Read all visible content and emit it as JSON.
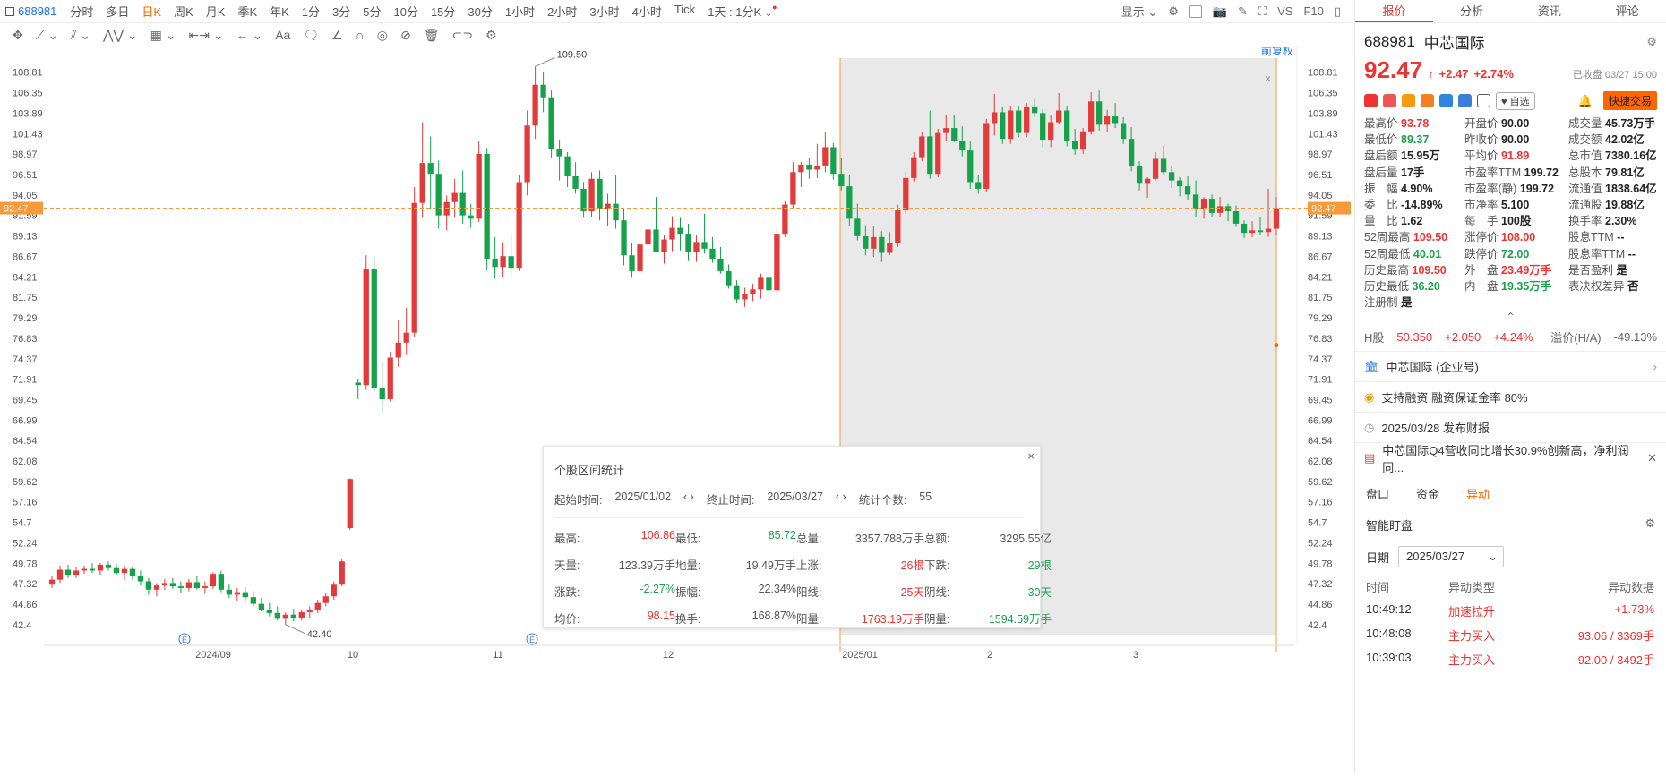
{
  "toolbar": {
    "code": "688981",
    "periods": [
      "分时",
      "多日",
      "日K",
      "周K",
      "月K",
      "季K",
      "年K",
      "1分",
      "3分",
      "5分",
      "10分",
      "15分",
      "30分",
      "1小时",
      "2小时",
      "3小时",
      "4小时",
      "Tick"
    ],
    "active_period": "日K",
    "interval": "1天 : 1分K",
    "display": "显示",
    "vs": "VS",
    "f10": "F10",
    "adjust": "前复权"
  },
  "chart_data": {
    "type": "candlestick",
    "ylim": [
      41.2,
      110.5
    ],
    "y_ticks": [
      108.81,
      106.35,
      103.89,
      101.43,
      98.97,
      96.51,
      94.05,
      91.59,
      89.13,
      86.67,
      84.21,
      81.75,
      79.29,
      76.83,
      74.37,
      71.91,
      69.45,
      66.99,
      64.54,
      62.08,
      59.62,
      57.16,
      54.7,
      52.24,
      49.78,
      47.32,
      44.86,
      42.4
    ],
    "x_labels": [
      "2024/09",
      "10",
      "11",
      "12",
      "2025/01",
      "2",
      "3"
    ],
    "current_price": "92.47",
    "high_label": "109.50",
    "low_label": "42.40",
    "event_markers": [
      "E",
      "E"
    ],
    "candles": [
      [
        47.2,
        48.2,
        46.8,
        47.8
      ],
      [
        47.8,
        49.5,
        47.4,
        49.0
      ],
      [
        49.0,
        49.6,
        48.0,
        48.4
      ],
      [
        48.4,
        49.3,
        48.0,
        48.9
      ],
      [
        48.9,
        49.5,
        48.5,
        49.1
      ],
      [
        49.1,
        49.8,
        48.6,
        48.9
      ],
      [
        48.9,
        49.8,
        48.4,
        49.6
      ],
      [
        49.6,
        50.0,
        48.9,
        49.2
      ],
      [
        49.2,
        49.7,
        48.4,
        48.6
      ],
      [
        48.6,
        49.5,
        47.8,
        49.1
      ],
      [
        49.1,
        49.4,
        47.8,
        48.2
      ],
      [
        48.2,
        48.9,
        47.1,
        47.6
      ],
      [
        47.6,
        48.0,
        46.0,
        46.6
      ],
      [
        46.6,
        47.4,
        45.8,
        47.1
      ],
      [
        47.1,
        47.9,
        46.6,
        47.4
      ],
      [
        47.4,
        48.0,
        46.7,
        47.0
      ],
      [
        47.0,
        47.6,
        46.2,
        46.8
      ],
      [
        46.8,
        47.9,
        46.4,
        47.5
      ],
      [
        47.5,
        48.3,
        46.6,
        46.8
      ],
      [
        46.8,
        47.6,
        46.1,
        47.0
      ],
      [
        47.0,
        48.7,
        46.7,
        48.5
      ],
      [
        48.5,
        48.9,
        46.3,
        46.6
      ],
      [
        46.6,
        47.2,
        45.6,
        46.0
      ],
      [
        46.0,
        46.8,
        45.3,
        46.3
      ],
      [
        46.3,
        46.9,
        45.2,
        45.7
      ],
      [
        45.7,
        46.4,
        44.6,
        44.9
      ],
      [
        44.9,
        45.6,
        44.0,
        44.2
      ],
      [
        44.2,
        45.0,
        43.4,
        43.8
      ],
      [
        43.8,
        44.6,
        42.9,
        43.1
      ],
      [
        43.1,
        43.9,
        42.4,
        43.6
      ],
      [
        43.6,
        44.3,
        42.8,
        43.2
      ],
      [
        43.2,
        44.2,
        42.9,
        43.9
      ],
      [
        43.9,
        44.6,
        43.2,
        44.2
      ],
      [
        44.2,
        45.4,
        43.8,
        45.0
      ],
      [
        45.0,
        46.2,
        44.6,
        45.8
      ],
      [
        45.8,
        47.6,
        45.4,
        47.2
      ],
      [
        47.2,
        50.3,
        47.0,
        50.0
      ],
      [
        54.0,
        60.0,
        53.8,
        59.9
      ],
      [
        71.5,
        72.0,
        69.5,
        71.2
      ],
      [
        71.2,
        86.8,
        70.6,
        85.1
      ],
      [
        85.1,
        86.6,
        70.4,
        70.9
      ],
      [
        70.9,
        74.0,
        67.9,
        69.5
      ],
      [
        69.5,
        75.2,
        69.2,
        74.5
      ],
      [
        74.5,
        79.0,
        73.4,
        76.3
      ],
      [
        76.3,
        80.5,
        74.8,
        77.5
      ],
      [
        77.5,
        95.0,
        77.0,
        93.1
      ],
      [
        93.1,
        102.8,
        91.3,
        97.9
      ],
      [
        97.9,
        101.1,
        92.4,
        96.6
      ],
      [
        96.6,
        98.2,
        90.0,
        91.6
      ],
      [
        91.6,
        94.0,
        89.8,
        93.2
      ],
      [
        93.2,
        96.0,
        91.3,
        94.3
      ],
      [
        94.3,
        97.0,
        90.6,
        91.6
      ],
      [
        91.6,
        93.0,
        90.1,
        91.2
      ],
      [
        91.2,
        100.5,
        90.8,
        99.0
      ],
      [
        99.0,
        99.7,
        85.0,
        86.4
      ],
      [
        86.4,
        89.0,
        84.0,
        85.4
      ],
      [
        85.4,
        88.4,
        84.2,
        86.7
      ],
      [
        86.7,
        89.5,
        84.3,
        85.3
      ],
      [
        85.3,
        96.4,
        84.9,
        95.6
      ],
      [
        95.6,
        104.2,
        94.0,
        102.4
      ],
      [
        102.4,
        109.5,
        100.8,
        107.3
      ],
      [
        107.3,
        108.8,
        104.0,
        105.8
      ],
      [
        105.8,
        106.7,
        98.5,
        99.6
      ],
      [
        99.6,
        100.7,
        95.8,
        98.7
      ],
      [
        98.7,
        99.2,
        95.0,
        96.3
      ],
      [
        96.3,
        98.0,
        94.2,
        94.8
      ],
      [
        94.8,
        95.6,
        91.3,
        92.1
      ],
      [
        92.1,
        96.8,
        91.4,
        96.0
      ],
      [
        96.0,
        97.0,
        91.0,
        92.4
      ],
      [
        92.4,
        94.2,
        90.3,
        93.0
      ],
      [
        93.0,
        96.5,
        90.0,
        91.0
      ],
      [
        91.0,
        92.4,
        85.6,
        86.8
      ],
      [
        86.8,
        88.3,
        84.1,
        84.9
      ],
      [
        84.9,
        89.4,
        83.5,
        88.1
      ],
      [
        88.1,
        90.1,
        86.3,
        89.9
      ],
      [
        89.9,
        93.8,
        88.9,
        87.2
      ],
      [
        87.2,
        89.2,
        85.8,
        88.7
      ],
      [
        88.7,
        91.5,
        87.3,
        90.1
      ],
      [
        90.1,
        91.3,
        87.4,
        89.4
      ],
      [
        89.4,
        90.6,
        86.1,
        87.2
      ],
      [
        87.2,
        89.2,
        86.0,
        88.4
      ],
      [
        88.4,
        91.8,
        87.0,
        87.6
      ],
      [
        87.6,
        89.0,
        85.9,
        86.4
      ],
      [
        86.4,
        87.8,
        84.6,
        84.9
      ],
      [
        84.9,
        85.7,
        82.8,
        83.2
      ],
      [
        83.2,
        83.8,
        81.1,
        81.5
      ],
      [
        81.5,
        82.9,
        80.6,
        82.2
      ],
      [
        82.2,
        83.4,
        81.3,
        82.7
      ],
      [
        82.7,
        84.6,
        81.6,
        84.1
      ],
      [
        84.1,
        84.7,
        81.6,
        82.6
      ],
      [
        82.6,
        90.1,
        81.8,
        89.4
      ],
      [
        89.4,
        93.3,
        89.0,
        92.9
      ],
      [
        92.9,
        98.0,
        92.5,
        96.8
      ],
      [
        96.8,
        98.0,
        95.0,
        97.7
      ],
      [
        97.7,
        98.5,
        96.0,
        97.1
      ],
      [
        97.1,
        100.2,
        96.1,
        97.6
      ],
      [
        97.6,
        101.6,
        96.8,
        99.8
      ],
      [
        99.8,
        100.3,
        95.9,
        96.6
      ],
      [
        96.6,
        98.5,
        94.6,
        95.1
      ],
      [
        95.1,
        96.5,
        90.3,
        91.2
      ],
      [
        91.2,
        93.0,
        88.6,
        89.1
      ],
      [
        89.1,
        90.4,
        86.8,
        87.6
      ],
      [
        87.6,
        90.3,
        86.6,
        89.0
      ],
      [
        89.0,
        89.7,
        86.0,
        87.1
      ],
      [
        87.1,
        89.6,
        86.8,
        88.3
      ],
      [
        88.3,
        92.9,
        87.8,
        92.2
      ],
      [
        92.2,
        96.8,
        91.8,
        96.1
      ],
      [
        96.1,
        99.2,
        95.7,
        98.6
      ],
      [
        98.6,
        101.6,
        98.1,
        101.1
      ],
      [
        101.1,
        104.2,
        96.0,
        96.6
      ],
      [
        96.6,
        102.0,
        96.2,
        101.5
      ],
      [
        101.5,
        103.7,
        100.6,
        102.1
      ],
      [
        102.1,
        103.6,
        100.4,
        100.6
      ],
      [
        100.6,
        102.3,
        98.7,
        99.4
      ],
      [
        99.4,
        100.5,
        94.8,
        95.6
      ],
      [
        95.6,
        96.5,
        94.2,
        94.8
      ],
      [
        94.8,
        103.2,
        94.4,
        102.7
      ],
      [
        102.7,
        106.2,
        101.2,
        104.0
      ],
      [
        104.0,
        104.6,
        100.2,
        100.8
      ],
      [
        100.8,
        104.8,
        100.2,
        104.2
      ],
      [
        104.2,
        104.8,
        101.0,
        101.5
      ],
      [
        101.5,
        105.1,
        101.0,
        104.7
      ],
      [
        104.7,
        105.6,
        103.4,
        103.9
      ],
      [
        103.9,
        104.4,
        99.8,
        100.7
      ],
      [
        100.7,
        103.6,
        99.8,
        102.8
      ],
      [
        102.8,
        106.3,
        102.6,
        104.2
      ],
      [
        104.2,
        104.8,
        99.9,
        100.5
      ],
      [
        100.5,
        102.0,
        98.9,
        99.5
      ],
      [
        99.5,
        102.1,
        99.0,
        101.7
      ],
      [
        101.7,
        106.4,
        101.3,
        105.3
      ],
      [
        105.3,
        106.6,
        101.8,
        102.5
      ],
      [
        102.5,
        104.3,
        101.6,
        103.5
      ],
      [
        103.5,
        105.1,
        102.1,
        102.7
      ],
      [
        102.7,
        103.4,
        100.2,
        100.8
      ],
      [
        100.8,
        102.2,
        96.9,
        97.5
      ],
      [
        97.5,
        98.1,
        94.6,
        95.4
      ],
      [
        95.4,
        96.2,
        93.7,
        96.0
      ],
      [
        96.0,
        99.2,
        95.8,
        98.4
      ],
      [
        98.4,
        100.0,
        96.5,
        96.8
      ],
      [
        96.8,
        97.6,
        94.9,
        95.8
      ],
      [
        95.8,
        96.2,
        93.9,
        95.1
      ],
      [
        95.1,
        96.3,
        93.5,
        94.1
      ],
      [
        94.1,
        95.8,
        91.4,
        92.4
      ],
      [
        92.4,
        93.8,
        91.2,
        93.6
      ],
      [
        93.6,
        94.1,
        91.4,
        91.9
      ],
      [
        91.9,
        93.8,
        91.4,
        92.7
      ],
      [
        92.7,
        93.0,
        90.9,
        92.1
      ],
      [
        92.1,
        92.8,
        90.2,
        90.6
      ],
      [
        90.6,
        91.0,
        88.9,
        89.5
      ],
      [
        89.5,
        90.9,
        89.0,
        89.8
      ],
      [
        89.8,
        91.4,
        89.2,
        89.6
      ],
      [
        89.6,
        94.8,
        89.0,
        90.0
      ],
      [
        90.0,
        93.8,
        89.3,
        92.47
      ]
    ]
  },
  "range_stats": {
    "title": "个股区间统计",
    "start_label": "起始时间:",
    "start": "2025/01/02",
    "end_label": "终止时间:",
    "end": "2025/03/27",
    "count_label": "统计个数:",
    "count": "55",
    "rows": [
      [
        [
          "最高:",
          "106.86",
          "red"
        ],
        [
          "最低:",
          "85.72",
          "green"
        ],
        [
          "总量:",
          "3357.788万手",
          "dark"
        ],
        [
          "总额:",
          "3295.55亿",
          "dark"
        ]
      ],
      [
        [
          "天量:",
          "123.39万手",
          "dark"
        ],
        [
          "地量:",
          "19.49万手",
          "dark"
        ],
        [
          "上涨:",
          "26根",
          "red"
        ],
        [
          "下跌:",
          "29根",
          "green"
        ]
      ],
      [
        [
          "涨跌:",
          "-2.27%",
          "green"
        ],
        [
          "振幅:",
          "22.34%",
          "dark"
        ],
        [
          "阳线:",
          "25天",
          "red"
        ],
        [
          "阴线:",
          "30天",
          "green"
        ]
      ],
      [
        [
          "均价:",
          "98.15",
          "red"
        ],
        [
          "换手:",
          "168.87%",
          "dark"
        ],
        [
          "阳量:",
          "1763.19万手",
          "red"
        ],
        [
          "阴量:",
          "1594.59万手",
          "green"
        ]
      ]
    ]
  },
  "panel": {
    "tabs": [
      "报价",
      "分析",
      "资讯",
      "评论"
    ],
    "code": "688981",
    "name": "中芯国际",
    "price": "92.47",
    "change": "+2.47",
    "change_pct": "+2.74%",
    "closed": "已收盘 03/27 15:00",
    "watch": "自选",
    "quick_trade": "快捷交易",
    "stats": [
      [
        "最高价",
        "93.78",
        "red"
      ],
      [
        "开盘价",
        "90.00",
        "dark"
      ],
      [
        "成交量",
        "45.73万手",
        "dark"
      ],
      [
        "最低价",
        "89.37",
        "green"
      ],
      [
        "昨收价",
        "90.00",
        "dark"
      ],
      [
        "成交额",
        "42.02亿",
        "dark"
      ],
      [
        "盘后额",
        "15.95万",
        "dark"
      ],
      [
        "平均价",
        "91.89",
        "red"
      ],
      [
        "总市值",
        "7380.16亿",
        "dark"
      ],
      [
        "盘后量",
        "17手",
        "dark"
      ],
      [
        "市盈率TTM",
        "199.72",
        "dark"
      ],
      [
        "总股本",
        "79.81亿",
        "dark"
      ],
      [
        "振　幅",
        "4.90%",
        "dark"
      ],
      [
        "市盈率(静)",
        "199.72",
        "dark"
      ],
      [
        "流通值",
        "1838.64亿",
        "dark"
      ],
      [
        "委　比",
        "-14.89%",
        "dark"
      ],
      [
        "市净率",
        "5.100",
        "dark"
      ],
      [
        "流通股",
        "19.88亿",
        "dark"
      ],
      [
        "量　比",
        "1.62",
        "dark"
      ],
      [
        "每　手",
        "100股",
        "dark"
      ],
      [
        "换手率",
        "2.30%",
        "dark"
      ],
      [
        "52周最高",
        "109.50",
        "red"
      ],
      [
        "涨停价",
        "108.00",
        "red"
      ],
      [
        "股息TTM",
        "--",
        "dark"
      ],
      [
        "52周最低",
        "40.01",
        "green"
      ],
      [
        "跌停价",
        "72.00",
        "green"
      ],
      [
        "股息率TTM",
        "--",
        "dark"
      ],
      [
        "历史最高",
        "109.50",
        "red"
      ],
      [
        "外　盘",
        "23.49万手",
        "red"
      ],
      [
        "是否盈利",
        "是",
        "dark"
      ],
      [
        "历史最低",
        "36.20",
        "green"
      ],
      [
        "内　盘",
        "19.35万手",
        "green"
      ],
      [
        "表决权差异",
        "否",
        "dark"
      ],
      [
        "注册制",
        "是",
        "dark"
      ]
    ],
    "h_share": {
      "label": "H股",
      "price": "50.350",
      "change": "+2.050",
      "pct": "+4.24%",
      "premium_label": "溢价(H/A)",
      "premium": "-49.13%"
    },
    "info_rows": [
      "中芯国际 (企业号)",
      "支持融资 融资保证金率 80%",
      "2025/03/28  发布财报",
      "中芯国际Q4营收同比增长30.9%创新高，净利润同..."
    ],
    "subtabs": [
      "盘口",
      "资金",
      "异动"
    ],
    "smart": {
      "title": "智能盯盘",
      "date_label": "日期",
      "date": "2025/03/27",
      "headers": [
        "时间",
        "异动类型",
        "异动数据"
      ],
      "rows": [
        [
          "10:49:12",
          "加速拉升",
          "+1.73%"
        ],
        [
          "10:48:08",
          "主力买入",
          "93.06 / 3369手"
        ],
        [
          "10:39:03",
          "主力买入",
          "92.00 / 3492手"
        ]
      ]
    }
  },
  "colors": {
    "up": "#e33b3b",
    "down": "#14a24a",
    "accent": "#ff6a00",
    "link": "#1a73e8"
  }
}
